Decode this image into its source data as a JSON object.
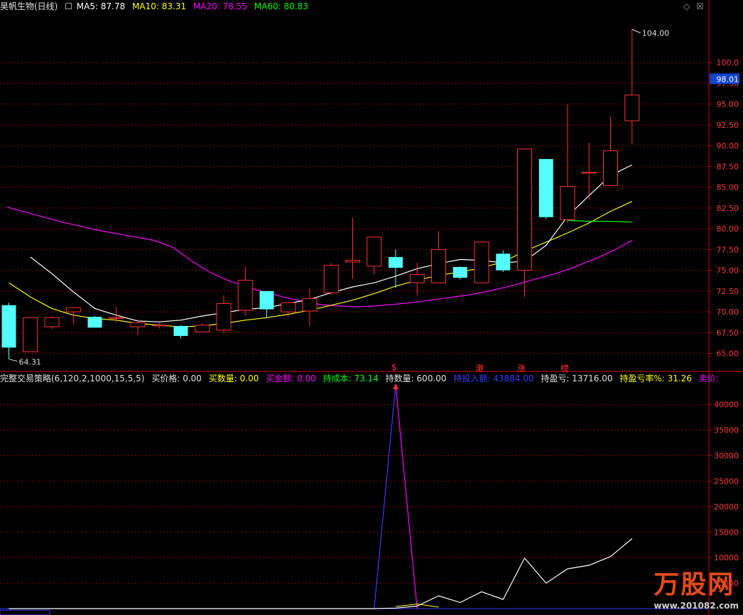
{
  "header": {
    "stock_name": "昊帆生物(日线)",
    "ma5_label": "MA5:",
    "ma5_value": "87.78",
    "ma10_label": "MA10:",
    "ma10_value": "83.31",
    "ma20_label": "MA20:",
    "ma20_value": "78.55",
    "ma60_label": "MA60:",
    "ma60_value": "80.83"
  },
  "controls": {
    "diamond": "◇",
    "close": "☒"
  },
  "price_axis": {
    "ticks": [
      "100.0",
      "97.50",
      "95.00",
      "92.50",
      "90.00",
      "87.50",
      "85.00",
      "82.50",
      "80.00",
      "77.50",
      "75.00",
      "72.50",
      "70.00",
      "67.50",
      "65.00"
    ],
    "current_price": "98.01",
    "high_marker": "104.00",
    "low_marker": "64.31"
  },
  "event_badges": [
    "$",
    "港",
    "涨",
    "榜"
  ],
  "indicator": {
    "name": "完整交易策略(6,120,2,1000,15,5,5)",
    "buy_price_label": "买价格:",
    "buy_price": "0.00",
    "buy_qty_label": "买数量:",
    "buy_qty": "0.00",
    "buy_amount_label": "买金额:",
    "buy_amount": "0.00",
    "hold_cost_label": "持成本:",
    "hold_cost": "73.14",
    "hold_qty_label": "持数量:",
    "hold_qty": "600.00",
    "hold_invest_label": "持投入额:",
    "hold_invest": "43884.00",
    "hold_pnl_label": "持盈亏:",
    "hold_pnl": "13716.00",
    "hold_pnl_pct_label": "持盈亏率%:",
    "hold_pnl_pct": "31.26",
    "sell_label": "卖价:",
    "axis_ticks": [
      "40000",
      "35000",
      "30000",
      "25000",
      "20000",
      "15000",
      "10000",
      "5000"
    ]
  },
  "colors": {
    "up": "#ff3232",
    "down": "#54ffff",
    "ma5": "#ffffff",
    "ma10": "#ffff00",
    "ma20": "#ff00ff",
    "ma60": "#00ff00",
    "grid": "#8b0000",
    "axis": "#cc0000"
  },
  "chart_data": {
    "type": "candlestick",
    "price_ylim": [
      63,
      106
    ],
    "candles": [
      {
        "o": 70.8,
        "h": 71.1,
        "l": 64.3,
        "c": 65.7
      },
      {
        "o": 65.2,
        "h": 69.3,
        "l": 65.2,
        "c": 69.3
      },
      {
        "o": 68.2,
        "h": 69.5,
        "l": 67.9,
        "c": 69.3
      },
      {
        "o": 70.0,
        "h": 70.6,
        "l": 68.5,
        "c": 70.5
      },
      {
        "o": 69.4,
        "h": 69.5,
        "l": 68.1,
        "c": 68.1
      },
      {
        "o": 69.3,
        "h": 70.6,
        "l": 68.7,
        "c": 69.3
      },
      {
        "o": 68.2,
        "h": 69.1,
        "l": 67.2,
        "c": 68.7
      },
      {
        "o": 68.4,
        "h": 68.8,
        "l": 68.0,
        "c": 68.4
      },
      {
        "o": 68.3,
        "h": 68.4,
        "l": 66.8,
        "c": 67.1
      },
      {
        "o": 67.6,
        "h": 68.6,
        "l": 67.6,
        "c": 68.4
      },
      {
        "o": 67.8,
        "h": 72.0,
        "l": 67.4,
        "c": 71.0
      },
      {
        "o": 70.2,
        "h": 75.4,
        "l": 69.6,
        "c": 73.8
      },
      {
        "o": 72.5,
        "h": 72.5,
        "l": 69.3,
        "c": 70.3
      },
      {
        "o": 70.0,
        "h": 71.2,
        "l": 69.4,
        "c": 71.1
      },
      {
        "o": 70.1,
        "h": 72.8,
        "l": 68.3,
        "c": 71.6
      },
      {
        "o": 72.3,
        "h": 75.9,
        "l": 72.0,
        "c": 75.6
      },
      {
        "o": 76.0,
        "h": 81.3,
        "l": 74.0,
        "c": 76.2
      },
      {
        "o": 75.5,
        "h": 79.0,
        "l": 74.5,
        "c": 79.0
      },
      {
        "o": 76.6,
        "h": 77.5,
        "l": 72.9,
        "c": 75.3
      },
      {
        "o": 73.5,
        "h": 75.9,
        "l": 72.0,
        "c": 74.5
      },
      {
        "o": 73.5,
        "h": 79.7,
        "l": 73.5,
        "c": 77.5
      },
      {
        "o": 75.4,
        "h": 75.5,
        "l": 73.9,
        "c": 74.1
      },
      {
        "o": 73.5,
        "h": 78.5,
        "l": 73.5,
        "c": 78.4
      },
      {
        "o": 77.0,
        "h": 77.4,
        "l": 74.8,
        "c": 75.0
      },
      {
        "o": 75.0,
        "h": 89.6,
        "l": 71.8,
        "c": 89.6
      },
      {
        "o": 88.4,
        "h": 88.4,
        "l": 81.2,
        "c": 81.4
      },
      {
        "o": 81.1,
        "h": 95.0,
        "l": 80.7,
        "c": 85.1
      },
      {
        "o": 86.7,
        "h": 90.4,
        "l": 83.5,
        "c": 86.8
      },
      {
        "o": 85.2,
        "h": 93.5,
        "l": 85.2,
        "c": 89.4
      },
      {
        "o": 93.0,
        "h": 104.0,
        "l": 90.2,
        "c": 96.1
      }
    ],
    "ma5": [
      76.6,
      74.6,
      72.4,
      70.4,
      69.6,
      68.9,
      68.8,
      69.0,
      69.5,
      69.9,
      70.3,
      70.5,
      71.0,
      71.5,
      72.3,
      73.0,
      73.5,
      74.3,
      75.2,
      75.8,
      76.3,
      76.2,
      75.9,
      76.1,
      78.0,
      81.5,
      84.0,
      86.4,
      87.7
    ],
    "ma10": [
      73.5,
      71.8,
      70.4,
      69.6,
      69.2,
      69.0,
      68.6,
      68.4,
      68.2,
      68.3,
      68.6,
      69.0,
      69.3,
      69.7,
      70.2,
      70.8,
      71.4,
      72.2,
      73.1,
      73.8,
      74.4,
      74.8,
      75.3,
      76.0,
      77.3,
      78.4,
      79.5,
      80.7,
      82.1,
      83.3
    ],
    "ma20": [
      82.6,
      82.0,
      81.4,
      80.8,
      80.3,
      79.8,
      79.4,
      79.0,
      78.6,
      77.8,
      76.2,
      74.8,
      73.8,
      73.0,
      72.4,
      71.8,
      71.3,
      70.9,
      70.7,
      70.6,
      70.7,
      70.9,
      71.1,
      71.4,
      71.7,
      72.0,
      72.4,
      72.9,
      73.5,
      74.1,
      74.7,
      75.5,
      76.4,
      77.4,
      78.6
    ],
    "ma60_segment": [
      81.0,
      80.9,
      80.9,
      80.8
    ],
    "indicator_ylim": [
      0,
      44000
    ],
    "hold_invest_line": [
      0,
      0,
      0,
      0,
      0,
      0,
      0,
      0,
      0,
      0,
      0,
      0,
      0,
      0,
      0,
      0,
      0,
      0,
      43884,
      0,
      0,
      0,
      0,
      0,
      0,
      0,
      0,
      0,
      0,
      0
    ],
    "hold_pnl_line": [
      0,
      0,
      0,
      0,
      0,
      0,
      0,
      0,
      0,
      0,
      0,
      0,
      0,
      0,
      0,
      0,
      0,
      0,
      100,
      500,
      2500,
      1200,
      3300,
      1800,
      9900,
      5000,
      7800,
      8500,
      10200,
      13716
    ]
  }
}
